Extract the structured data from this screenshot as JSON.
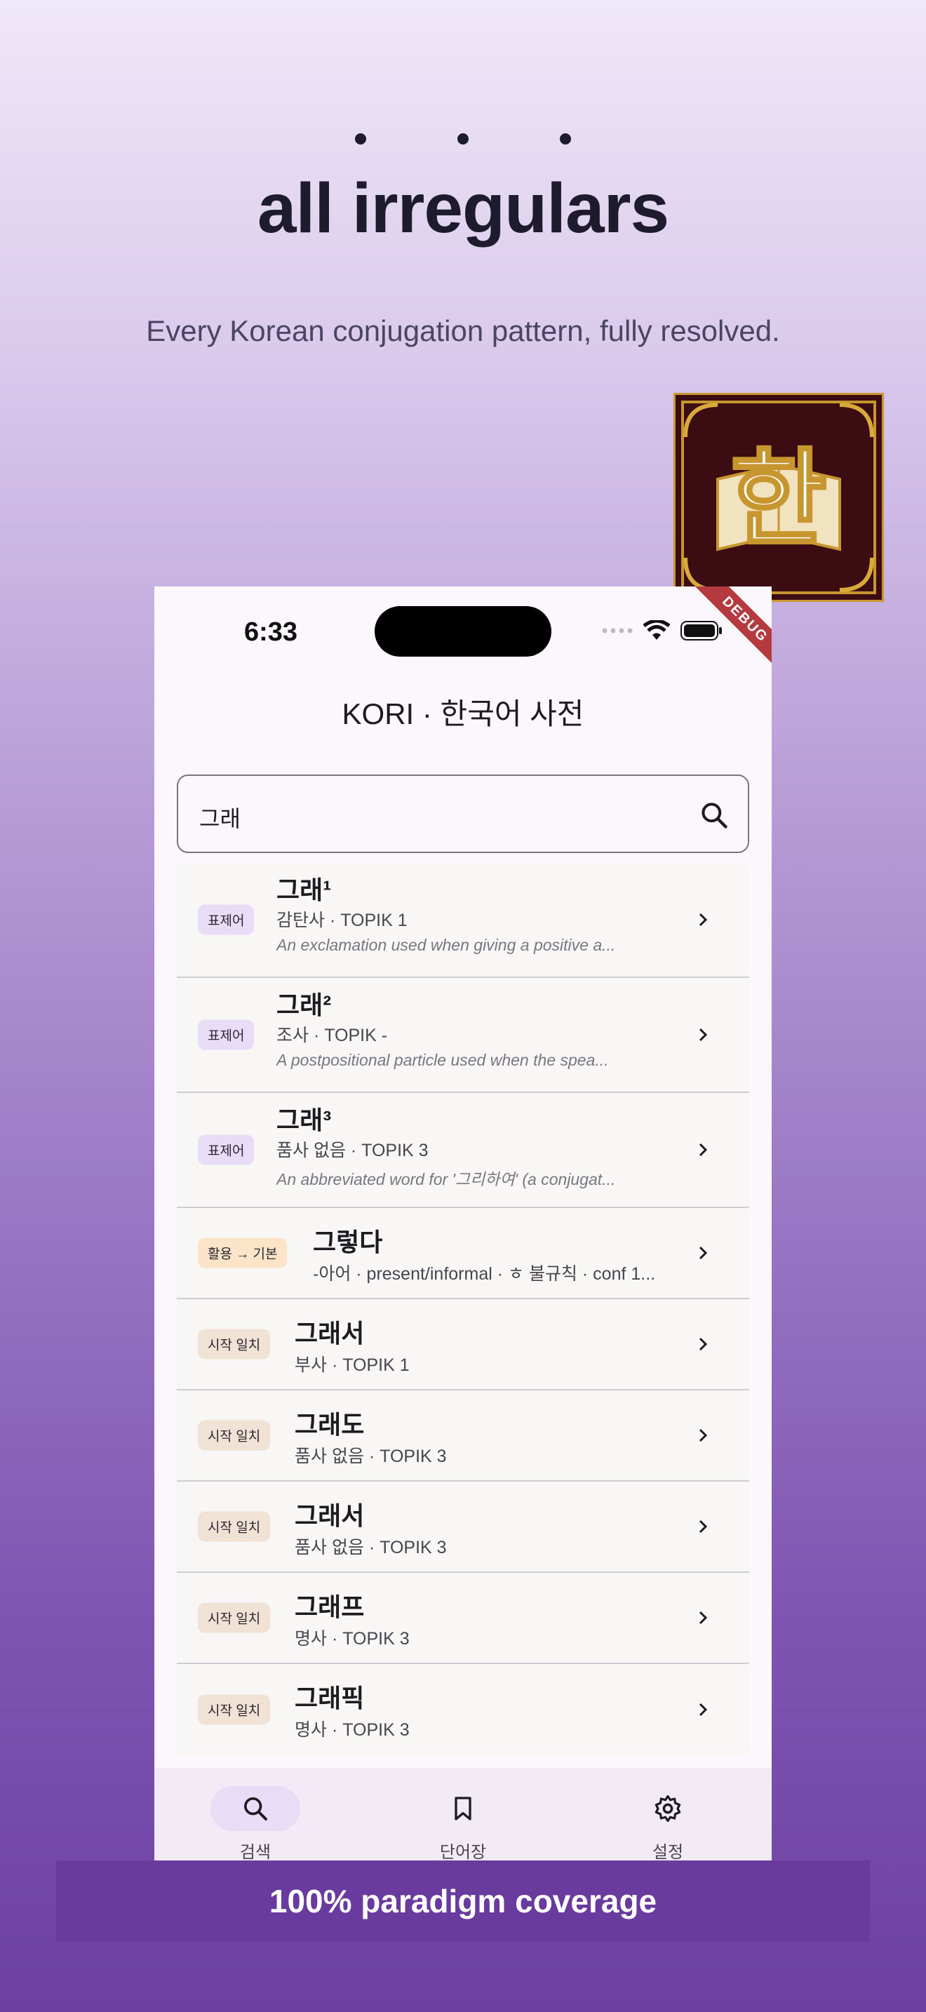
{
  "promo": {
    "headline": "all irregulars",
    "subhead": "Every Korean conjugation pattern, fully resolved.",
    "banner": "100% paradigm coverage"
  },
  "logo": {
    "glyph": "한",
    "bg_color": "#3b0d12",
    "frame_color": "#c8962e"
  },
  "status_bar": {
    "time": "6:33",
    "debug_label": "DEBUG"
  },
  "app": {
    "title": "KORI · 한국어 사전",
    "search": {
      "value": "그래",
      "icon": "search-icon"
    }
  },
  "results": [
    {
      "badge": "표제어",
      "word": "그래¹",
      "meta": "감탄사 · TOPIK 1",
      "desc": "An exclamation used when giving a positive a..."
    },
    {
      "badge": "표제어",
      "word": "그래²",
      "meta": "조사 · TOPIK -",
      "desc": "A postpositional particle used when the spea..."
    },
    {
      "badge": "표제어",
      "word": "그래³",
      "meta": "품사 없음 · TOPIK 3",
      "desc": "An abbreviated word for '그리하여' (a conjugat..."
    },
    {
      "badge": "활용 → 기본",
      "word": "그렇다",
      "meta": "-아어 · present/informal · ㅎ 불규칙 · conf 1...",
      "desc": ""
    },
    {
      "badge": "시작 일치",
      "word": "그래서",
      "meta": "부사 · TOPIK 1",
      "desc": ""
    },
    {
      "badge": "시작 일치",
      "word": "그래도",
      "meta": "품사 없음 · TOPIK 3",
      "desc": ""
    },
    {
      "badge": "시작 일치",
      "word": "그래서",
      "meta": "품사 없음 · TOPIK 3",
      "desc": ""
    },
    {
      "badge": "시작 일치",
      "word": "그래프",
      "meta": "명사 · TOPIK 3",
      "desc": ""
    },
    {
      "badge": "시작 일치",
      "word": "그래픽",
      "meta": "명사 · TOPIK 3",
      "desc": ""
    }
  ],
  "nav": [
    {
      "label": "검색",
      "icon": "search-icon",
      "active": true
    },
    {
      "label": "단어장",
      "icon": "bookmark-icon",
      "active": false
    },
    {
      "label": "설정",
      "icon": "gear-icon",
      "active": false
    }
  ],
  "colors": {
    "accent_pill": "#e8dcf6",
    "nav_bg": "#f2ebf5",
    "banner_bg": "#6a3b9e"
  }
}
